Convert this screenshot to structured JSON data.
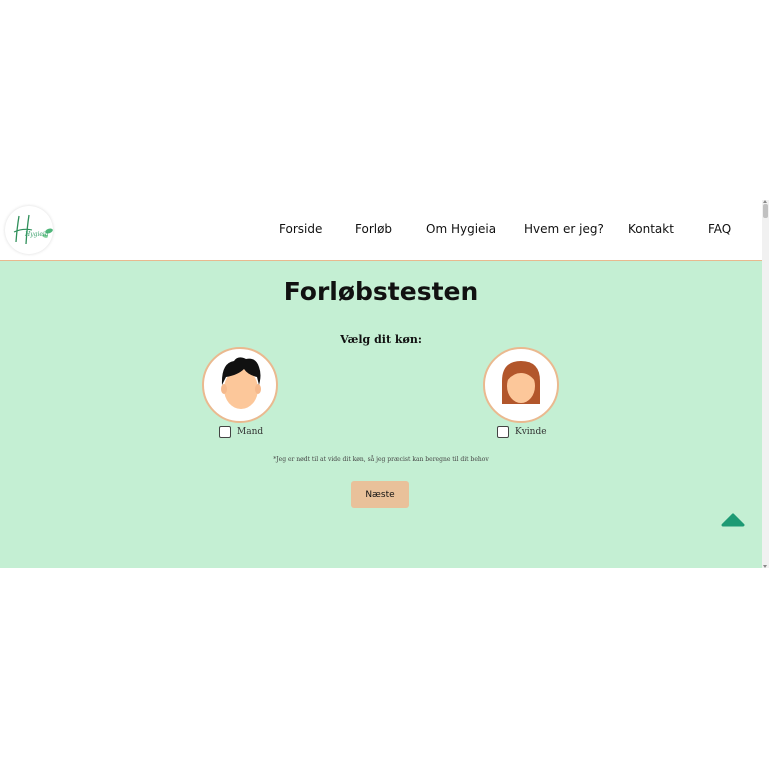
{
  "nav": {
    "items": [
      "Forside",
      "Forløb",
      "Om Hygieia",
      "Hvem er jeg?",
      "Kontakt",
      "FAQ"
    ]
  },
  "logo": {
    "text": "Hygieia"
  },
  "page": {
    "title": "Forløbstesten",
    "subtitle": "Vælg dit køn:",
    "note": "*Jeg er nødt til at vide dit køn, så jeg præcist kan beregne til dit behov",
    "next_label": "Næste"
  },
  "options": {
    "male_label": "Mand",
    "female_label": "Kvinde"
  },
  "colors": {
    "background": "#c4efd3",
    "accent": "#e9c19a",
    "avatar_border": "#eab98f",
    "top_button": "#1e9a74"
  },
  "icons": {
    "top_button": "chevron-up-icon",
    "male": "male-avatar-icon",
    "female": "female-avatar-icon"
  }
}
